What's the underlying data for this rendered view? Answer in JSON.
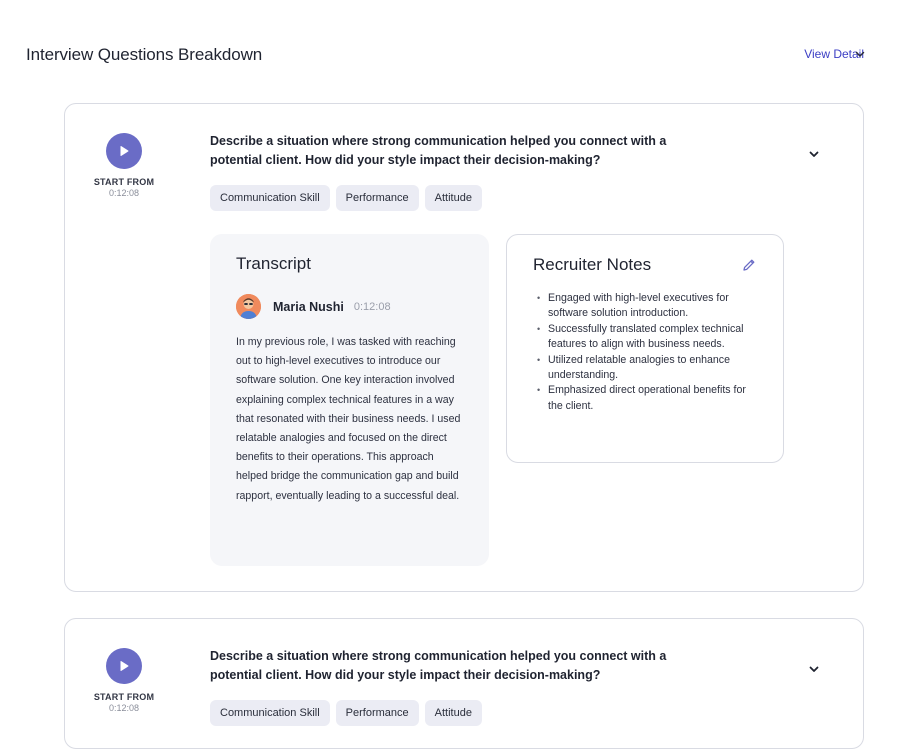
{
  "header": {
    "title": "Interview Questions Breakdown",
    "view_detail": "View Detail"
  },
  "cards": [
    {
      "start_label": "START FROM",
      "start_time": "0:12:08",
      "question": "Describe a situation where strong communication helped you connect with a potential client. How did your style impact their decision-making?",
      "tags": [
        "Communication Skill",
        "Performance",
        "Attitude"
      ],
      "transcript": {
        "title": "Transcript",
        "speaker": "Maria Nushi",
        "time": "0:12:08",
        "text": "In my previous role, I was tasked with reaching out to high-level executives to introduce our software solution. One key interaction involved explaining complex technical features in a way that resonated with their business needs. I used relatable analogies and focused on the direct benefits to their operations. This approach helped bridge the communication gap and build rapport, eventually leading to a successful deal."
      },
      "notes": {
        "title": "Recruiter Notes",
        "items": [
          "Engaged with high-level executives for software solution introduction.",
          "Successfully translated complex technical features to align with business needs.",
          "Utilized relatable analogies to enhance understanding.",
          "Emphasized direct operational benefits for the client."
        ]
      }
    },
    {
      "start_label": "START FROM",
      "start_time": "0:12:08",
      "question": "Describe a situation where strong communication helped you connect with a potential client. How did your style impact their decision-making?",
      "tags": [
        "Communication Skill",
        "Performance",
        "Attitude"
      ]
    }
  ],
  "icons": {
    "play": "play-icon",
    "chevron": "chevron-down-icon",
    "edit": "pencil-icon"
  },
  "colors": {
    "accent": "#6a6cc6",
    "link": "#3b3ec4",
    "tag_bg": "#ebecf4",
    "transcript_bg": "#f5f6f9"
  }
}
